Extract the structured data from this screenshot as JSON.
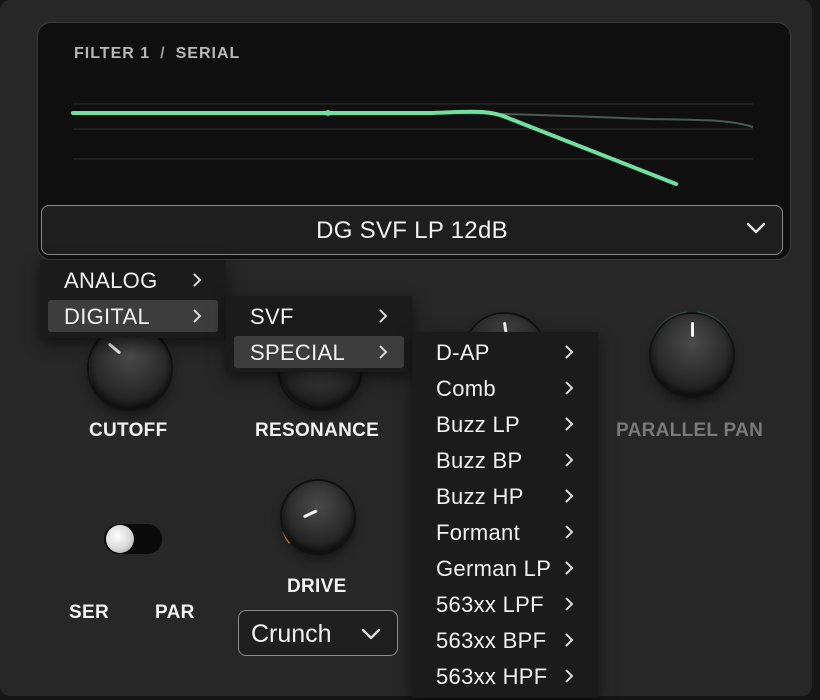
{
  "display": {
    "filter_name": "FILTER 1",
    "routing_mode": "SERIAL",
    "separator": "/"
  },
  "filter_type_select": {
    "value": "DG SVF LP 12dB"
  },
  "knobs": {
    "cutoff": {
      "label": "CUTOFF"
    },
    "resonance": {
      "label": "RESONANCE"
    },
    "parallel_pan": {
      "label": "PARALLEL PAN"
    },
    "drive": {
      "label": "DRIVE"
    }
  },
  "routing_toggle": {
    "left_label": "SER",
    "right_label": "PAR"
  },
  "drive_select": {
    "value": "Crunch"
  },
  "menu_level1": {
    "items": [
      {
        "label": "ANALOG",
        "highlighted": false
      },
      {
        "label": "DIGITAL",
        "highlighted": true
      }
    ]
  },
  "menu_level2": {
    "items": [
      {
        "label": "SVF",
        "highlighted": false
      },
      {
        "label": "SPECIAL",
        "highlighted": true
      }
    ]
  },
  "menu_level3": {
    "items": [
      {
        "label": "D-AP"
      },
      {
        "label": "Comb"
      },
      {
        "label": "Buzz LP"
      },
      {
        "label": "Buzz BP"
      },
      {
        "label": "Buzz HP"
      },
      {
        "label": "Formant"
      },
      {
        "label": "German LP"
      },
      {
        "label": "563xx LPF"
      },
      {
        "label": "563xx BPF"
      },
      {
        "label": "563xx HPF"
      }
    ]
  },
  "colors": {
    "curve": "#6fe0a0",
    "drive_accent": "#e0955a",
    "panel": "#272727",
    "menu_bg": "#1b1b1b",
    "menu_highlight": "#3d3d3d"
  }
}
